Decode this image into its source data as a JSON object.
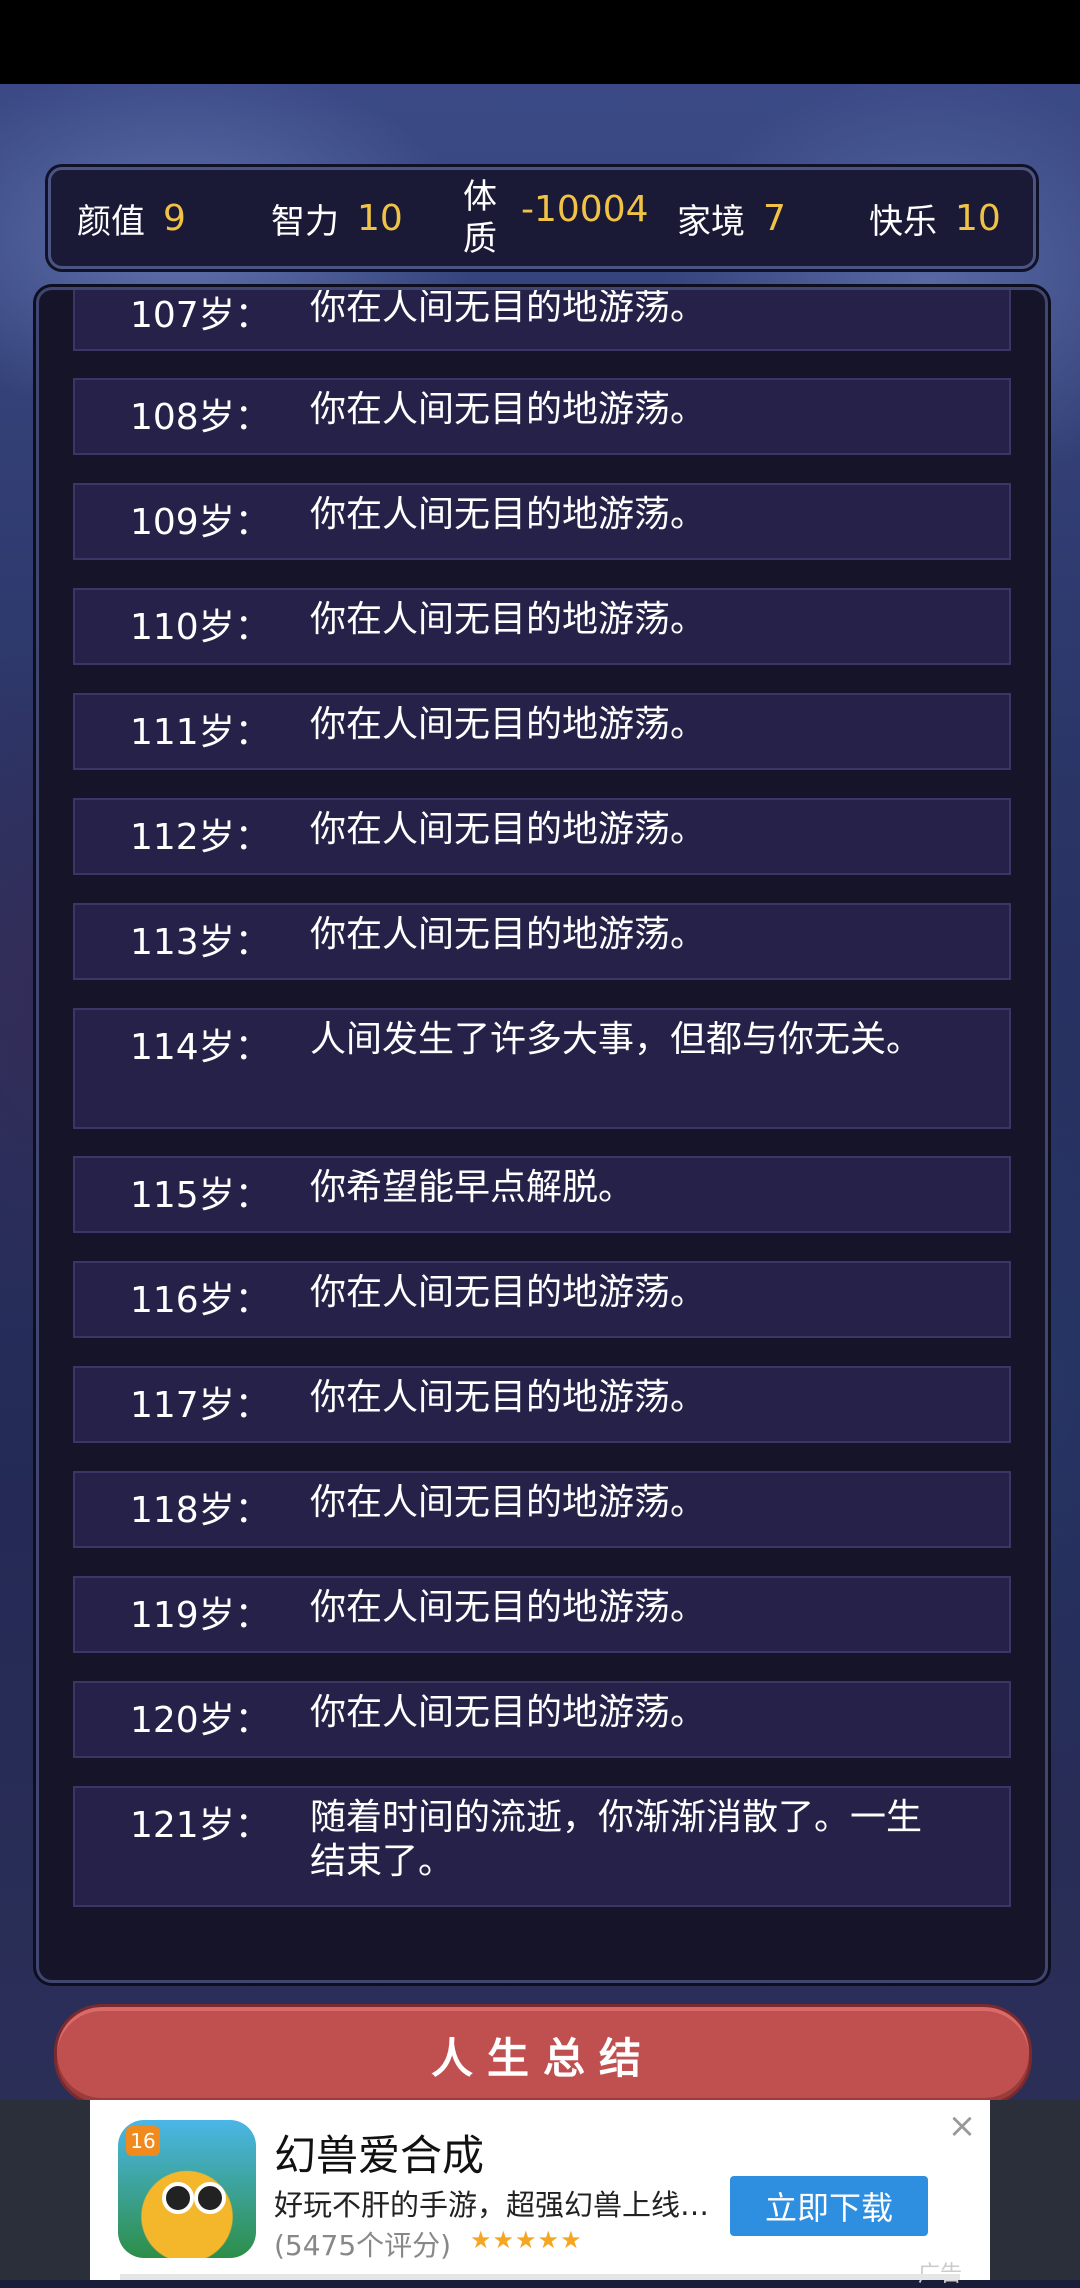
{
  "stats": [
    {
      "label": "颜值",
      "value": "9"
    },
    {
      "label": "智力",
      "value": "10"
    },
    {
      "label": "体质",
      "value": "-10004"
    },
    {
      "label": "家境",
      "value": "7"
    },
    {
      "label": "快乐",
      "value": "10"
    }
  ],
  "log": [
    {
      "age": "107岁：",
      "text": "你在人间无目的地游荡。"
    },
    {
      "age": "108岁：",
      "text": "你在人间无目的地游荡。"
    },
    {
      "age": "109岁：",
      "text": "你在人间无目的地游荡。"
    },
    {
      "age": "110岁：",
      "text": "你在人间无目的地游荡。"
    },
    {
      "age": "111岁：",
      "text": "你在人间无目的地游荡。"
    },
    {
      "age": "112岁：",
      "text": "你在人间无目的地游荡。"
    },
    {
      "age": "113岁：",
      "text": "你在人间无目的地游荡。"
    },
    {
      "age": "114岁：",
      "text": "人间发生了许多大事，但都与你无关。"
    },
    {
      "age": "115岁：",
      "text": "你希望能早点解脱。"
    },
    {
      "age": "116岁：",
      "text": "你在人间无目的地游荡。"
    },
    {
      "age": "117岁：",
      "text": "你在人间无目的地游荡。"
    },
    {
      "age": "118岁：",
      "text": "你在人间无目的地游荡。"
    },
    {
      "age": "119岁：",
      "text": "你在人间无目的地游荡。"
    },
    {
      "age": "120岁：",
      "text": "你在人间无目的地游荡。"
    },
    {
      "age": "121岁：",
      "text": "随着时间的流逝，你渐渐消散了。一生结束了。"
    }
  ],
  "summary_button": "人生总结",
  "ad": {
    "badge": "16",
    "title": "幻兽爱合成",
    "description": "好玩不肝的手游，超强幻兽上线…",
    "rating": "(5475个评分)",
    "stars": "★★★★★",
    "download": "立即下载",
    "close": "×",
    "tag": "广告"
  }
}
